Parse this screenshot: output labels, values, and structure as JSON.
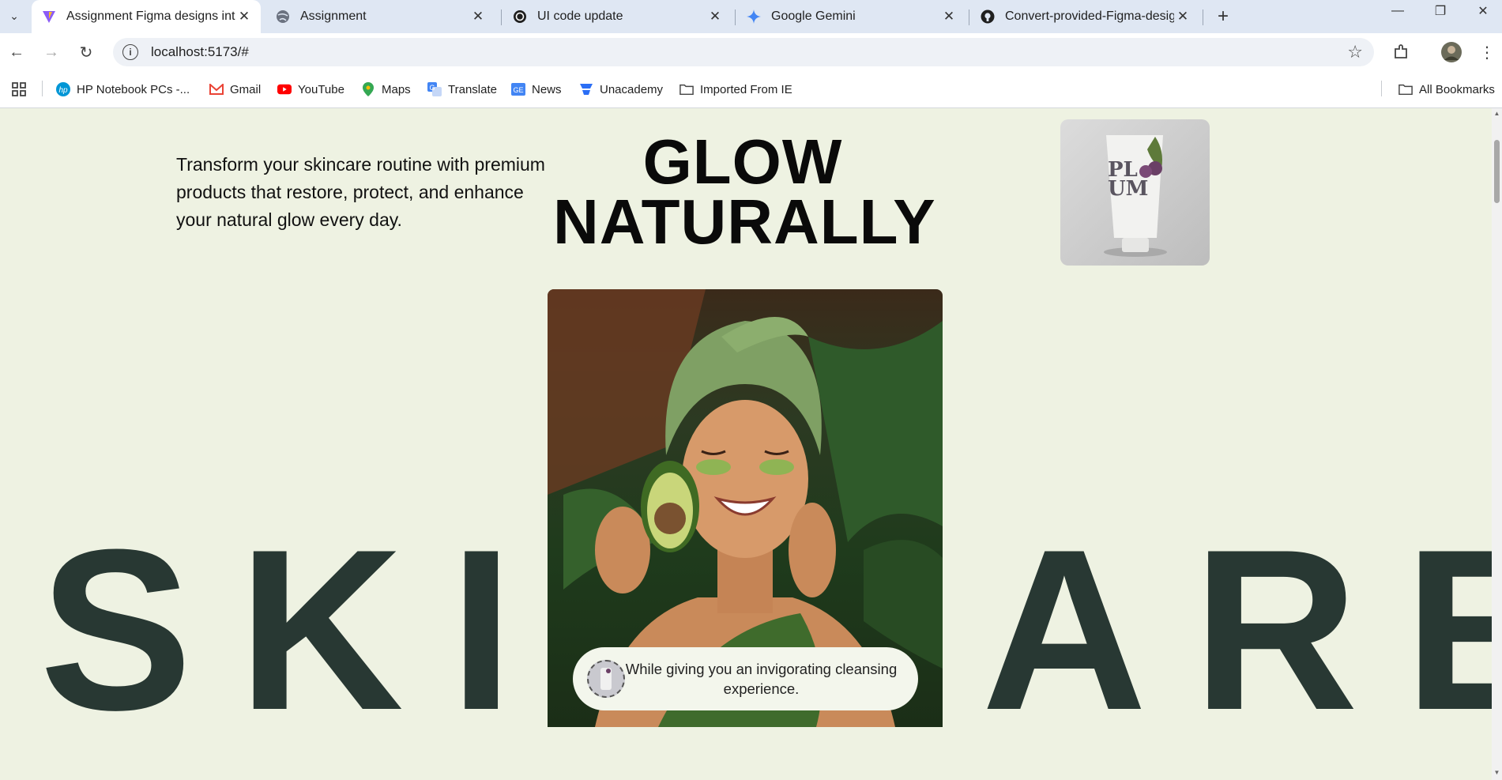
{
  "browser": {
    "tabs": [
      {
        "title": "Assignment Figma designs into",
        "active": true,
        "icon": "vite-icon"
      },
      {
        "title": "Assignment",
        "active": false,
        "icon": "globe-icon"
      },
      {
        "title": "UI code update",
        "active": false,
        "icon": "chatgpt-icon"
      },
      {
        "title": "Google Gemini",
        "active": false,
        "icon": "gemini-icon"
      },
      {
        "title": "Convert-provided-Figma-design",
        "active": false,
        "icon": "github-icon"
      }
    ],
    "url": "localhost:5173/#",
    "bookmarks": [
      {
        "label": "HP Notebook PCs -...",
        "icon": "hp-icon"
      },
      {
        "label": "Gmail",
        "icon": "gmail-icon"
      },
      {
        "label": "YouTube",
        "icon": "youtube-icon"
      },
      {
        "label": "Maps",
        "icon": "maps-icon"
      },
      {
        "label": "Translate",
        "icon": "translate-icon"
      },
      {
        "label": "News",
        "icon": "news-icon"
      },
      {
        "label": "Unacademy",
        "icon": "unacademy-icon"
      },
      {
        "label": "Imported From IE",
        "icon": "folder-icon"
      }
    ],
    "all_bookmarks": "All Bookmarks"
  },
  "page": {
    "tagline": "Transform your skincare routine with premium products that restore, protect, and enhance your natural glow every day.",
    "headline_line1": "GLOW",
    "headline_line2": "NATURALLY",
    "product_brand_line1": "PL",
    "product_brand_line2": "UM",
    "big_word": "SKINCARE",
    "pill_text": "While giving you an invigorating cleansing experience.",
    "colors": {
      "background": "#eef2e2",
      "big_word": "#283833",
      "headline": "#0a0a0a"
    }
  }
}
